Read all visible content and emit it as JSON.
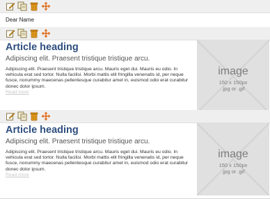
{
  "blocks": [
    {
      "type": "text",
      "text": "Dear Name"
    },
    {
      "type": "article",
      "heading": "Article heading",
      "subheading": "Adipiscing elit. Praesent tristique tristique arcu.",
      "body": "Adipiscing elit. Praesent tristique tristique arcu. Mauris eget dui. Mauris eu odio. In vehicula erat sed tortor. Nulla facilisi. Morbi mattis elit fringilla venenatis id, per neque fusce, nonummy maecenas pellentesque curabitur amet in, euismod odio erat curabitur donec dolor ipsum.",
      "read_more": "Read more",
      "image": {
        "title": "image",
        "size": "150 x 150px",
        "formats": ".jpg or .gif"
      }
    },
    {
      "type": "article",
      "heading": "Article heading",
      "subheading": "Adipiscing elit. Praesent tristique tristique arcu.",
      "body": "Adipiscing elit. Praesent tristique tristique arcu. Mauris eget dui. Mauris eu odio. In vehicula erat sed tortor. Nulla facilisi. Morbi mattis elit fringilla venenatis id, per neque fusce, nonummy maecenas pellentesque curabitur amet in, euismod odio erat curabitur donec dolor ipsum.",
      "read_more": "Read more",
      "image": {
        "title": "image",
        "size": "150 x 150px",
        "formats": ".jpg or .gif"
      }
    }
  ],
  "toolbar_icons": [
    "edit-icon",
    "copy-icon",
    "delete-icon",
    "move-icon"
  ],
  "colors": {
    "heading": "#2f4f7f",
    "toolbar_bg": "#efefef",
    "placeholder_bg": "#e0e0e0",
    "placeholder_text": "#7c7c7c",
    "read_more": "#c8c8c8"
  }
}
